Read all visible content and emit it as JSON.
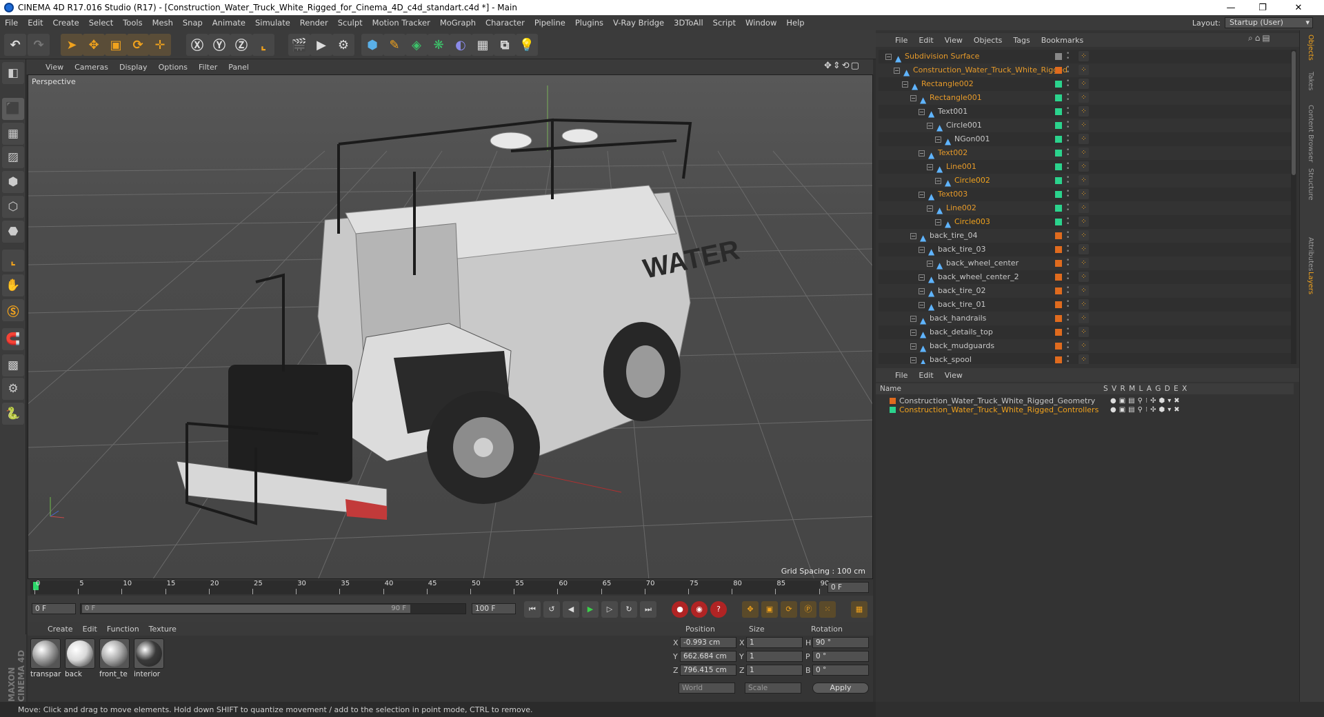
{
  "window": {
    "title": "CINEMA 4D R17.016 Studio (R17) - [Construction_Water_Truck_White_Rigged_for_Cinema_4D_c4d_standart.c4d *] - Main",
    "controls": [
      "—",
      "❐",
      "✕"
    ]
  },
  "menubar": [
    "File",
    "Edit",
    "Create",
    "Select",
    "Tools",
    "Mesh",
    "Snap",
    "Animate",
    "Simulate",
    "Render",
    "Sculpt",
    "Motion Tracker",
    "MoGraph",
    "Character",
    "Pipeline",
    "Plugins",
    "V-Ray Bridge",
    "3DToAll",
    "Script",
    "Window",
    "Help"
  ],
  "layout": {
    "label": "Layout:",
    "value": "Startup (User)"
  },
  "toolbar_icons": [
    "undo-icon",
    "redo-icon",
    "select-arrow-icon",
    "move-icon",
    "scale-icon",
    "rotate-icon",
    "live-select-icon",
    "x-axis-icon",
    "y-axis-icon",
    "z-axis-icon",
    "coordinate-system-icon",
    "render-view-icon",
    "render-picture-viewer-icon",
    "edit-render-settings-icon",
    "cube-primitive-icon",
    "pen-spline-icon",
    "subdivision-surface-icon",
    "array-icon",
    "deformer-icon",
    "floor-icon",
    "camera-icon",
    "light-icon"
  ],
  "left_tools": [
    "make-editable-icon",
    "model-mode-icon",
    "texture-mode-icon",
    "workplane-icon",
    "points-mode-icon",
    "edges-mode-icon",
    "polygons-mode-icon",
    "axis-icon",
    "tweak-icon",
    "snap-icon",
    "magnet-icon",
    "grid-lock-icon",
    "bake-icon",
    "python-icon"
  ],
  "viewport": {
    "menu": [
      "View",
      "Cameras",
      "Display",
      "Options",
      "Filter",
      "Panel"
    ],
    "label": "Perspective",
    "grid_spacing": "Grid Spacing : 100 cm",
    "truck_text": "WATER"
  },
  "timeline": {
    "ticks": [
      "0",
      "5",
      "10",
      "15",
      "20",
      "25",
      "30",
      "35",
      "40",
      "45",
      "50",
      "55",
      "60",
      "65",
      "70",
      "75",
      "80",
      "85",
      "90"
    ],
    "current": "0 F"
  },
  "transport": {
    "start": "0 F",
    "range_start": "0 F",
    "range_end": "90 F",
    "end": "100 F"
  },
  "materials": {
    "menu": [
      "Create",
      "Edit",
      "Function",
      "Texture"
    ],
    "items": [
      {
        "name": "transpar",
        "color": "#9a9a9a"
      },
      {
        "name": "back",
        "color": "#d8d8d8"
      },
      {
        "name": "front_te",
        "color": "#a8a8a8"
      },
      {
        "name": "interior",
        "color": "#3a3a3a"
      }
    ]
  },
  "coordinates": {
    "headers": [
      "Position",
      "Size",
      "Rotation"
    ],
    "rows": [
      {
        "axis": "X",
        "pos": "-0.993 cm",
        "size_axis": "X",
        "size": "1",
        "rot_axis": "H",
        "rot": "90 °"
      },
      {
        "axis": "Y",
        "pos": "662.684 cm",
        "size_axis": "Y",
        "size": "1",
        "rot_axis": "P",
        "rot": "0 °"
      },
      {
        "axis": "Z",
        "pos": "796.415 cm",
        "size_axis": "Z",
        "size": "1",
        "rot_axis": "B",
        "rot": "0 °"
      }
    ],
    "mode_world": "World",
    "mode_scale": "Scale",
    "apply": "Apply"
  },
  "statusbar": "Move: Click and drag to move elements. Hold down SHIFT to quantize movement / add to the selection in point mode, CTRL to remove.",
  "objects": {
    "menu": [
      "File",
      "Edit",
      "View",
      "Objects",
      "Tags",
      "Bookmarks"
    ],
    "rows": [
      {
        "name": "Subdivision Surface",
        "indent": 0,
        "color": "#e69a2a",
        "vis": "#888888"
      },
      {
        "name": "Construction_Water_Truck_White_Rigged",
        "indent": 1,
        "color": "#e69a2a",
        "vis": "#e06b1e"
      },
      {
        "name": "Rectangle002",
        "indent": 2,
        "color": "#e69a2a",
        "vis": "#2bd38d"
      },
      {
        "name": "Rectangle001",
        "indent": 3,
        "color": "#e69a2a",
        "vis": "#2bd38d"
      },
      {
        "name": "Text001",
        "indent": 4,
        "color": "#c8c8c8",
        "vis": "#2bd38d"
      },
      {
        "name": "Circle001",
        "indent": 5,
        "color": "#c8c8c8",
        "vis": "#2bd38d"
      },
      {
        "name": "NGon001",
        "indent": 6,
        "color": "#c8c8c8",
        "vis": "#2bd38d"
      },
      {
        "name": "Text002",
        "indent": 4,
        "color": "#e69a2a",
        "vis": "#2bd38d"
      },
      {
        "name": "Line001",
        "indent": 5,
        "color": "#e69a2a",
        "vis": "#2bd38d"
      },
      {
        "name": "Circle002",
        "indent": 6,
        "color": "#f0a21d",
        "vis": "#2bd38d"
      },
      {
        "name": "Text003",
        "indent": 4,
        "color": "#e69a2a",
        "vis": "#2bd38d"
      },
      {
        "name": "Line002",
        "indent": 5,
        "color": "#e69a2a",
        "vis": "#2bd38d"
      },
      {
        "name": "Circle003",
        "indent": 6,
        "color": "#f0a21d",
        "vis": "#2bd38d"
      },
      {
        "name": "back_tire_04",
        "indent": 3,
        "color": "#c8c8c8",
        "vis": "#e06b1e"
      },
      {
        "name": "back_tire_03",
        "indent": 4,
        "color": "#c8c8c8",
        "vis": "#e06b1e"
      },
      {
        "name": "back_wheel_center",
        "indent": 5,
        "color": "#c8c8c8",
        "vis": "#e06b1e"
      },
      {
        "name": "back_wheel_center_2",
        "indent": 4,
        "color": "#c8c8c8",
        "vis": "#e06b1e"
      },
      {
        "name": "back_tire_02",
        "indent": 4,
        "color": "#c8c8c8",
        "vis": "#e06b1e"
      },
      {
        "name": "back_tire_01",
        "indent": 4,
        "color": "#c8c8c8",
        "vis": "#e06b1e"
      },
      {
        "name": "back_handrails",
        "indent": 3,
        "color": "#c8c8c8",
        "vis": "#e06b1e"
      },
      {
        "name": "back_details_top",
        "indent": 3,
        "color": "#c8c8c8",
        "vis": "#e06b1e"
      },
      {
        "name": "back_mudguards",
        "indent": 3,
        "color": "#c8c8c8",
        "vis": "#e06b1e"
      },
      {
        "name": "back_spool",
        "indent": 3,
        "color": "#c8c8c8",
        "vis": "#e06b1e"
      }
    ]
  },
  "layers": {
    "menu": [
      "File",
      "Edit",
      "View"
    ],
    "headers": {
      "name": "Name",
      "cols": "S  V  R  M  L  A  G  D  E  X"
    },
    "rows": [
      {
        "name": "Construction_Water_Truck_White_Rigged_Geometry",
        "swatch": "#e06b1e",
        "color": "#c8c8c8"
      },
      {
        "name": "Construction_Water_Truck_White_Rigged_Controllers",
        "swatch": "#2bd38d",
        "color": "#f0a21d"
      }
    ]
  },
  "right_tabs": [
    "Objects",
    "Takes",
    "Content Browser",
    "Structure",
    "Attributes",
    "Layers"
  ]
}
